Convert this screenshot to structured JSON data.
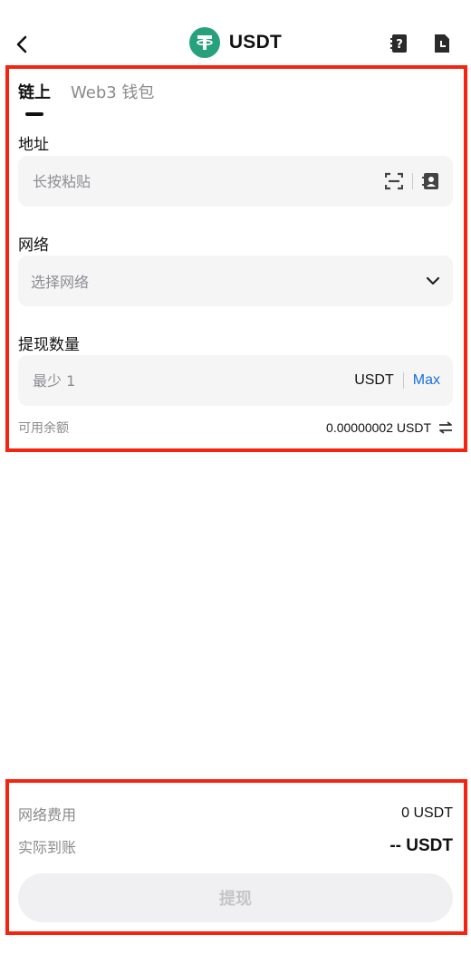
{
  "header": {
    "title": "USDT",
    "coin_logo_letter": "T",
    "brand_color": "#26a17b"
  },
  "tabs": [
    {
      "label": "链上",
      "active": true
    },
    {
      "label": "Web3 钱包",
      "active": false
    }
  ],
  "address": {
    "label": "地址",
    "placeholder": "长按粘贴",
    "scan_icon": "scan-icon",
    "contacts_icon": "address-book-icon"
  },
  "network": {
    "label": "网络",
    "placeholder": "选择网络",
    "dropdown_icon": "chevron-down-icon"
  },
  "amount": {
    "label": "提现数量",
    "placeholder": "最少 1",
    "unit": "USDT",
    "max_label": "Max"
  },
  "available": {
    "label": "可用余额",
    "value": "0.00000002 USDT"
  },
  "fees": {
    "network_fee_label": "网络费用",
    "network_fee_value": "0 USDT",
    "received_label": "实际到账",
    "received_value": "-- USDT"
  },
  "submit": {
    "label": "提现"
  },
  "colors": {
    "highlight": "#f5230f",
    "link": "#1a6ee0"
  }
}
